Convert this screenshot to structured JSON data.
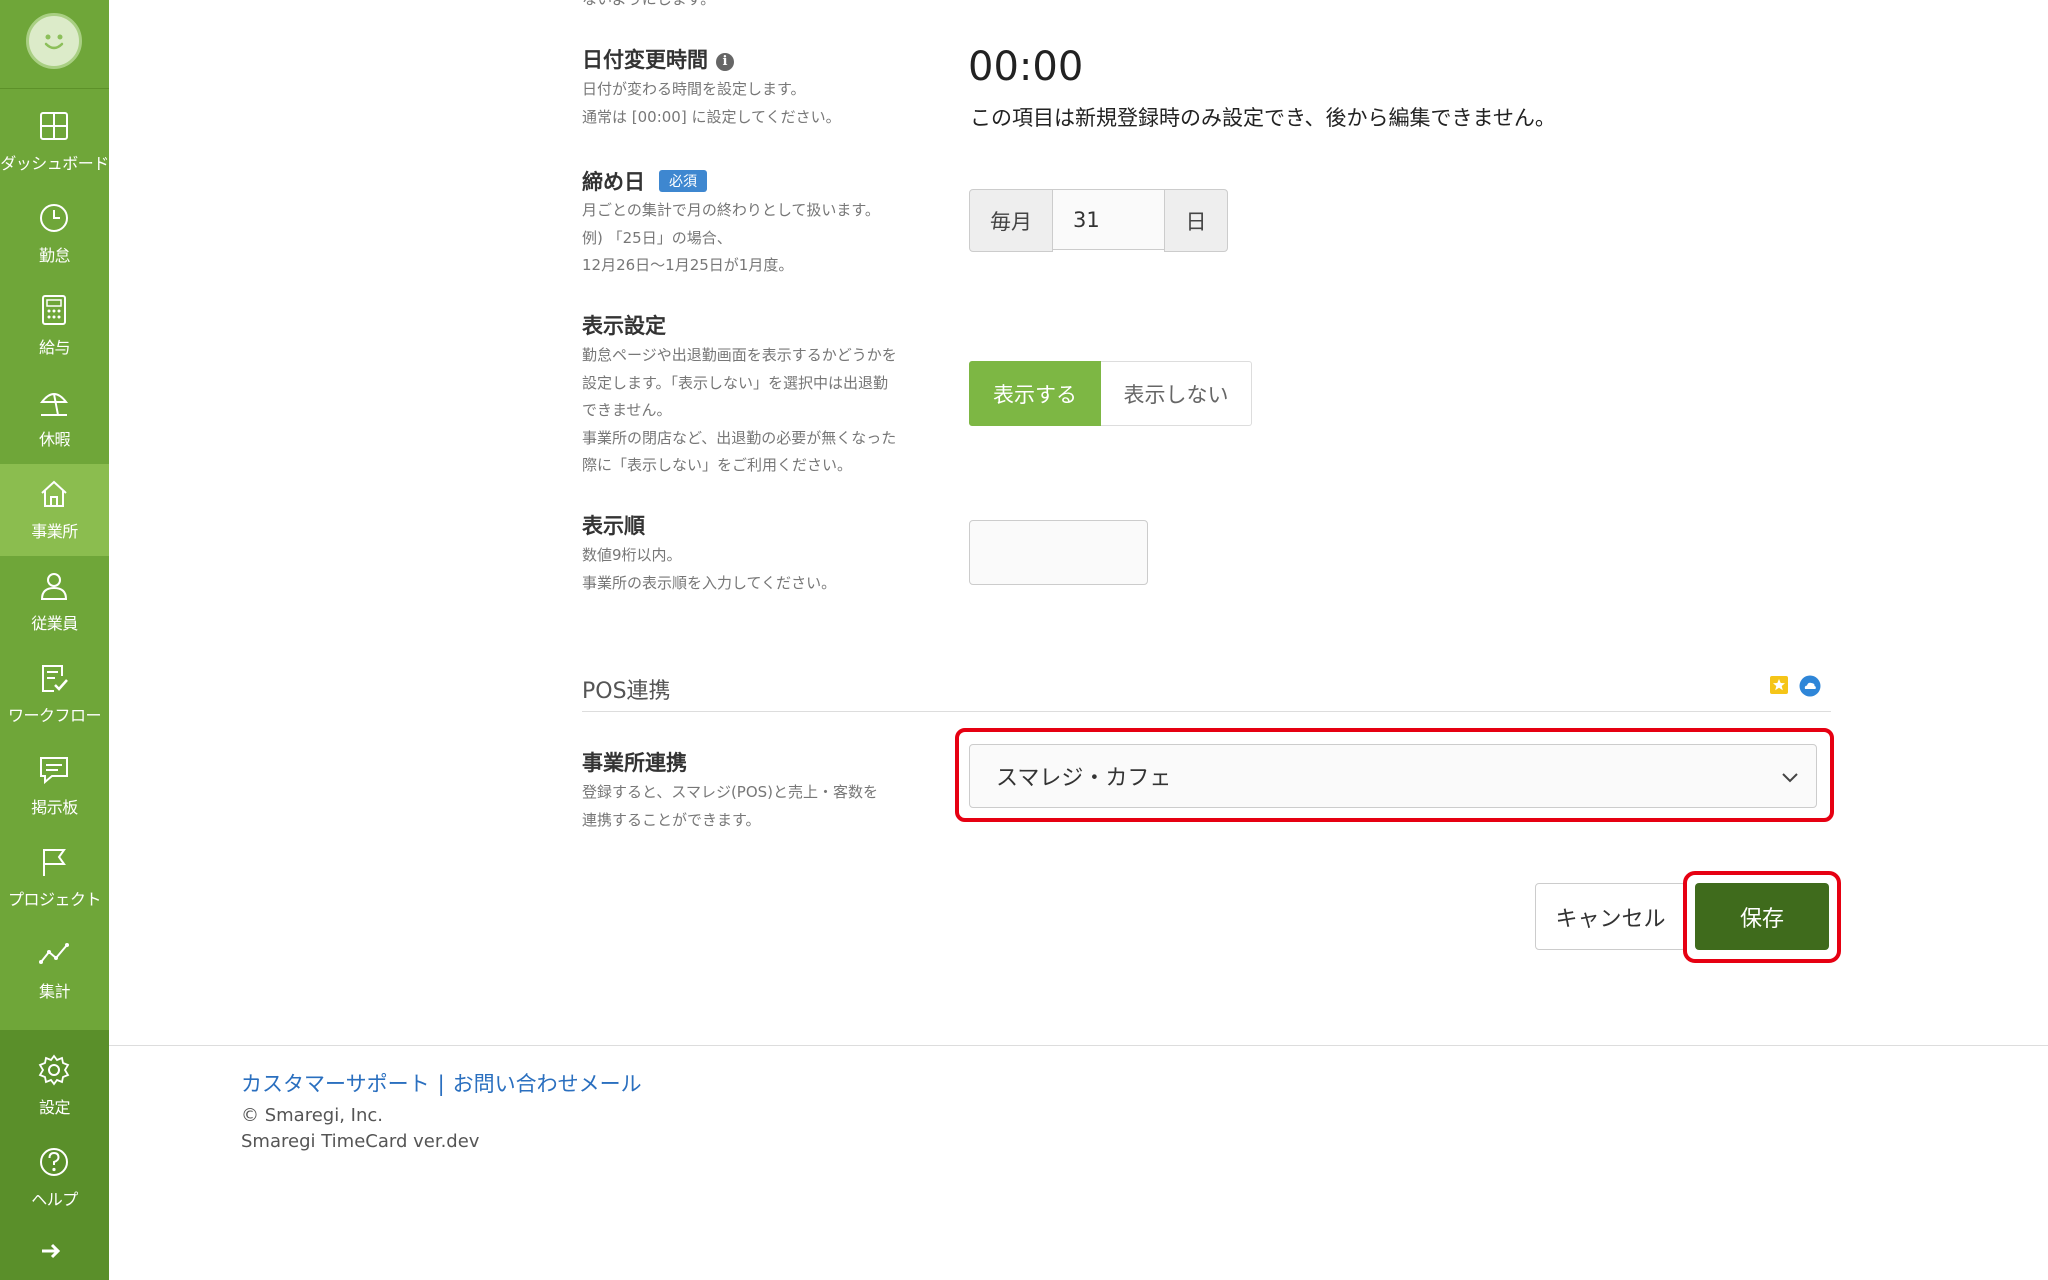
{
  "sidebar": {
    "items": [
      {
        "label": "ダッシュボード",
        "icon": "dashboard-icon"
      },
      {
        "label": "勤怠",
        "icon": "clock-icon"
      },
      {
        "label": "給与",
        "icon": "calculator-icon"
      },
      {
        "label": "休暇",
        "icon": "vacation-icon"
      },
      {
        "label": "事業所",
        "icon": "home-icon",
        "active": true
      },
      {
        "label": "従業員",
        "icon": "person-icon"
      },
      {
        "label": "ワークフロー",
        "icon": "checklist-icon"
      },
      {
        "label": "掲示板",
        "icon": "board-icon"
      },
      {
        "label": "プロジェクト",
        "icon": "flag-icon"
      },
      {
        "label": "集計",
        "icon": "chart-icon"
      }
    ],
    "bottom_items": [
      {
        "label": "設定",
        "icon": "gear-icon"
      },
      {
        "label": "ヘルプ",
        "icon": "help-icon"
      }
    ],
    "expand_icon": "arrow-right-icon"
  },
  "form": {
    "top_cut_text": "ないようにします。",
    "date_change": {
      "title": "日付変更時間",
      "desc": "日付が変わる時間を設定します。\n通常は [00:00] に設定してください。",
      "value": "00:00",
      "note": "この項目は新規登録時のみ設定でき、後から編集できません。"
    },
    "closing_day": {
      "title": "締め日",
      "badge": "必須",
      "desc": "月ごとの集計で月の終わりとして扱います。\n例) 「25日」の場合、\n12月26日〜1月25日が1月度。",
      "prefix": "毎月",
      "value": "31",
      "suffix": "日"
    },
    "display_setting": {
      "title": "表示設定",
      "desc": "勤怠ページや出退勤画面を表示するかどうかを\n設定します。「表示しない」を選択中は出退勤\nできません。\n事業所の閉店など、出退勤の必要が無くなった\n際に「表示しない」をご利用ください。",
      "on_label": "表示する",
      "off_label": "表示しない",
      "selected": "表示する"
    },
    "display_order": {
      "title": "表示順",
      "desc": "数値9桁以内。\n事業所の表示順を入力してください。",
      "value": ""
    },
    "pos_section": {
      "title": "POS連携"
    },
    "office_link": {
      "title": "事業所連携",
      "desc": "登録すると、スマレジ(POS)と売上・客数を\n連携することができます。",
      "selected": "スマレジ・カフェ"
    },
    "cancel_label": "キャンセル",
    "save_label": "保存"
  },
  "footer": {
    "support_link": "カスタマーサポート",
    "separator": "|",
    "contact_link": "お問い合わせメール",
    "copyright": "© Smaregi, Inc.",
    "version": "Smaregi TimeCard ver.dev"
  },
  "colors": {
    "sidebar": "#6fa639",
    "sidebar_active": "#8bbd4f",
    "toggle_on": "#7db744",
    "save_button": "#3f6b1c",
    "highlight": "#e60012",
    "link": "#2a6fbf",
    "badge": "#3e87d0"
  }
}
